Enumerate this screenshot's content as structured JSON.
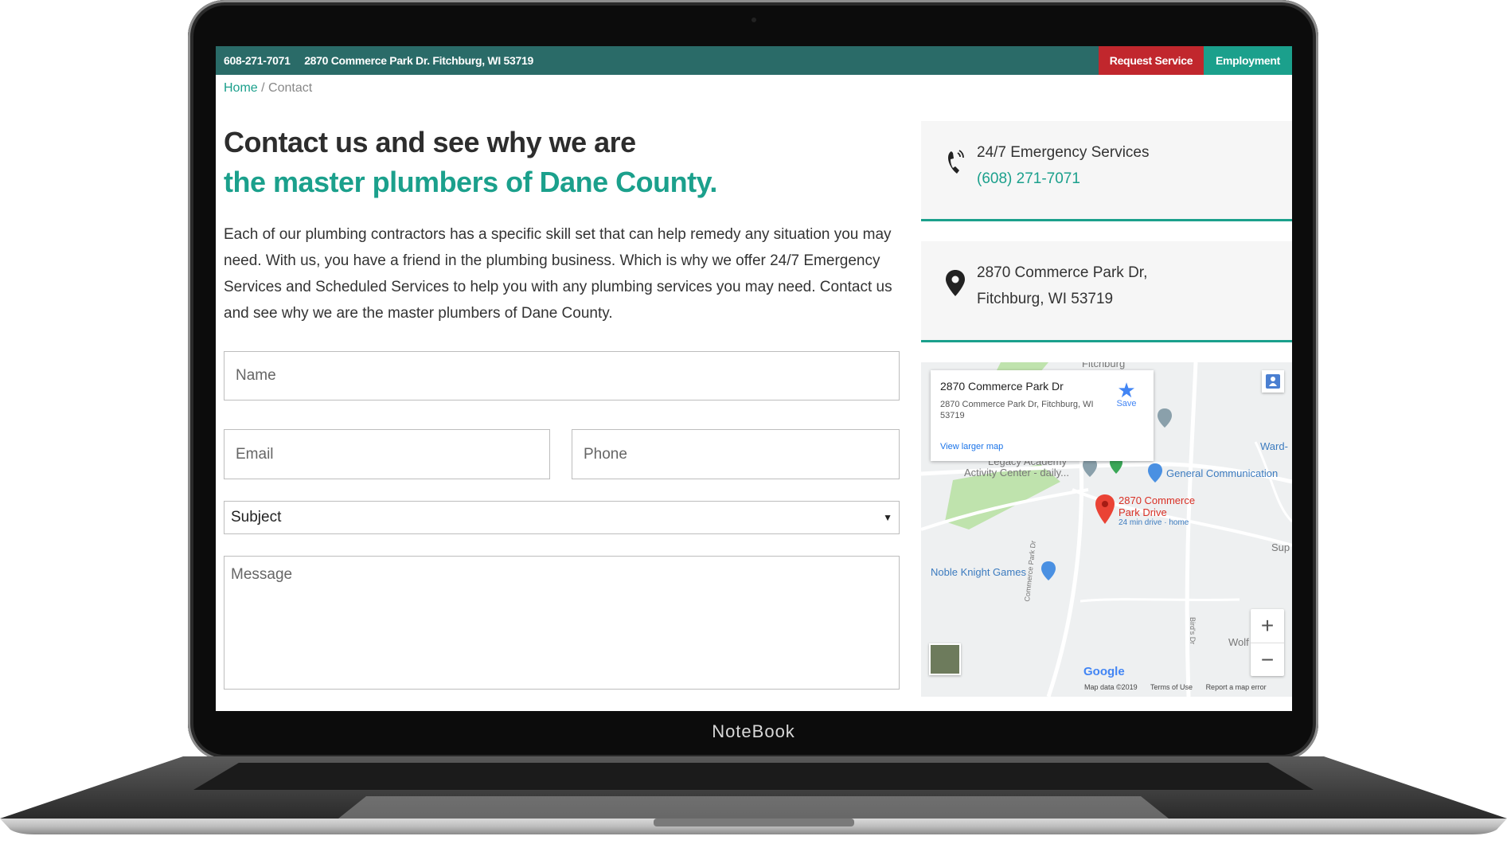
{
  "laptop": {
    "brand": "NoteBook"
  },
  "topbar": {
    "phone": "608-271-7071",
    "address": "2870 Commerce Park Dr. Fitchburg, WI 53719",
    "request_label": "Request Service",
    "employment_label": "Employment"
  },
  "breadcrumb": {
    "home": "Home",
    "separator": " / ",
    "current": "Contact"
  },
  "heading": {
    "line1": "Contact us and see why we are",
    "line2": "the master plumbers of Dane County."
  },
  "intro": "Each of our plumbing contractors has a specific skill set that can help remedy any situation you may need. With us, you have a friend in the plumbing business. Which is why we offer 24/7 Emergency Services and Scheduled Services to help you with any plumbing services you may need. Contact us and see why we are the master plumbers of Dane County.",
  "form": {
    "name_placeholder": "Name",
    "email_placeholder": "Email",
    "phone_placeholder": "Phone",
    "subject_value": "Subject",
    "message_placeholder": "Message"
  },
  "contact_cards": {
    "emergency_label": "24/7 Emergency Services",
    "emergency_phone": "(608) 271-7071",
    "address_line1": "2870 Commerce Park Dr,",
    "address_line2": "Fitchburg, WI 53719"
  },
  "map": {
    "popup_title": "2870 Commerce Park Dr",
    "popup_address": "2870 Commerce Park Dr, Fitchburg, WI 53719",
    "view_larger": "View larger map",
    "save_label": "Save",
    "town_label": "Fitchburg",
    "legacy_label_1": "Legacy Academy",
    "legacy_label_2": "Activity Center - daily...",
    "general_comm": "General Communication",
    "pin_label_1": "2870 Commerce",
    "pin_label_2": "Park Drive",
    "pin_sub": "24 min drive · home",
    "noble_knight": "Noble Knight Games",
    "ward": "Ward-",
    "sup": "Sup",
    "wolf": "Wolf A",
    "google": "Google",
    "map_data": "Map data ©2019",
    "terms": "Terms of Use",
    "report": "Report a map error",
    "zoom_in": "+",
    "zoom_out": "−",
    "street_commerce": "Commerce Park Dr",
    "street_bird": "Bird's Dr"
  },
  "colors": {
    "teal_bar": "#2a6b68",
    "accent": "#1ba08c",
    "request_red": "#c1272d"
  }
}
